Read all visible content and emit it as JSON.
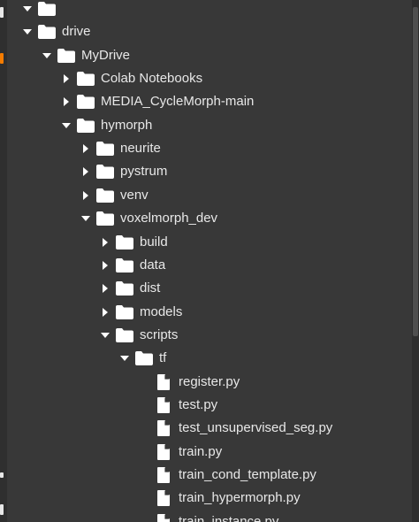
{
  "tree": {
    "items": [
      {
        "label": "",
        "kind": "folder",
        "state": "partial",
        "depth": 1
      },
      {
        "label": "drive",
        "kind": "folder",
        "state": "expanded",
        "depth": 1
      },
      {
        "label": "MyDrive",
        "kind": "folder",
        "state": "expanded",
        "depth": 2
      },
      {
        "label": "Colab Notebooks",
        "kind": "folder",
        "state": "collapsed",
        "depth": 3
      },
      {
        "label": "MEDIA_CycleMorph-main",
        "kind": "folder",
        "state": "collapsed",
        "depth": 3
      },
      {
        "label": "hymorph",
        "kind": "folder",
        "state": "expanded",
        "depth": 3
      },
      {
        "label": "neurite",
        "kind": "folder",
        "state": "collapsed",
        "depth": 4
      },
      {
        "label": "pystrum",
        "kind": "folder",
        "state": "collapsed",
        "depth": 4
      },
      {
        "label": "venv",
        "kind": "folder",
        "state": "collapsed",
        "depth": 4
      },
      {
        "label": "voxelmorph_dev",
        "kind": "folder",
        "state": "expanded",
        "depth": 4
      },
      {
        "label": "build",
        "kind": "folder",
        "state": "collapsed",
        "depth": 5
      },
      {
        "label": "data",
        "kind": "folder",
        "state": "collapsed",
        "depth": 5
      },
      {
        "label": "dist",
        "kind": "folder",
        "state": "collapsed",
        "depth": 5
      },
      {
        "label": "models",
        "kind": "folder",
        "state": "collapsed",
        "depth": 5
      },
      {
        "label": "scripts",
        "kind": "folder",
        "state": "expanded",
        "depth": 5
      },
      {
        "label": "tf",
        "kind": "folder",
        "state": "expanded",
        "depth": 6
      },
      {
        "label": "register.py",
        "kind": "file",
        "depth": 7
      },
      {
        "label": "test.py",
        "kind": "file",
        "depth": 7
      },
      {
        "label": "test_unsupervised_seg.py",
        "kind": "file",
        "depth": 7
      },
      {
        "label": "train.py",
        "kind": "file",
        "depth": 7
      },
      {
        "label": "train_cond_template.py",
        "kind": "file",
        "depth": 7
      },
      {
        "label": "train_hypermorph.py",
        "kind": "file",
        "depth": 7
      },
      {
        "label": "train_instance.py",
        "kind": "file",
        "depth": 7
      }
    ]
  },
  "colors": {
    "background": "#383838",
    "text": "#e8e8e8",
    "icon": "#ffffff",
    "left_accent": "#f57c00"
  }
}
